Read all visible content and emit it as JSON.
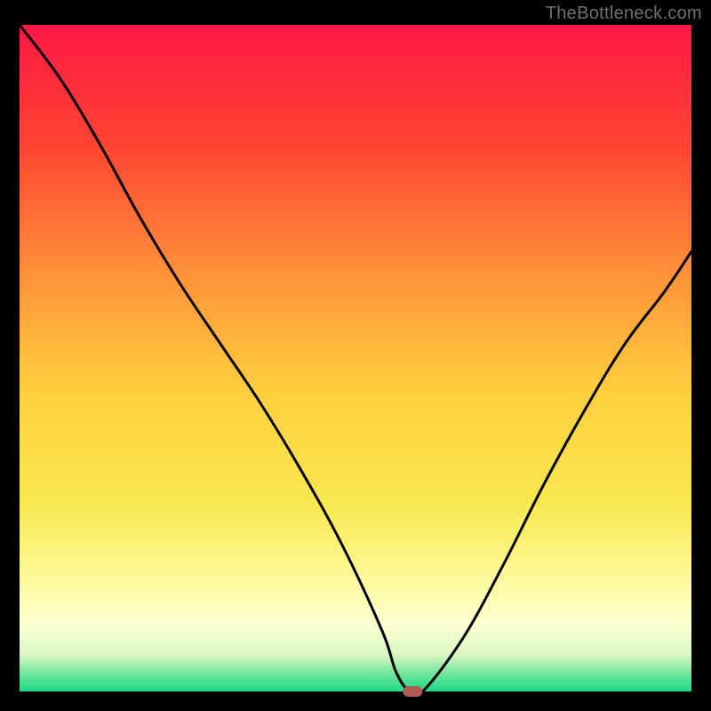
{
  "watermark": "TheBottleneck.com",
  "chart_data": {
    "type": "line",
    "title": "",
    "xlabel": "",
    "ylabel": "",
    "xlim": [
      0,
      100
    ],
    "ylim": [
      0,
      100
    ],
    "x": [
      0,
      6,
      12,
      18,
      24,
      30,
      36,
      42,
      48,
      54,
      56,
      58,
      60,
      66,
      72,
      78,
      84,
      90,
      96,
      100
    ],
    "values": [
      100,
      92,
      82,
      71,
      61,
      52,
      43,
      33,
      22,
      9,
      3,
      0,
      0,
      8,
      19,
      31,
      42,
      52,
      60,
      66
    ],
    "optimum_marker": {
      "x": 58.5,
      "y": 0,
      "color": "#b15a54"
    },
    "background_gradient": {
      "stops": [
        {
          "offset": 0.0,
          "color": "#ff1846"
        },
        {
          "offset": 0.18,
          "color": "#ff4432"
        },
        {
          "offset": 0.38,
          "color": "#ff943a"
        },
        {
          "offset": 0.55,
          "color": "#ffcf3e"
        },
        {
          "offset": 0.72,
          "color": "#f8e850"
        },
        {
          "offset": 0.83,
          "color": "#fff99a"
        },
        {
          "offset": 0.9,
          "color": "#feffd2"
        },
        {
          "offset": 0.945,
          "color": "#d9f8c3"
        },
        {
          "offset": 0.97,
          "color": "#7de7a0"
        },
        {
          "offset": 1.0,
          "color": "#1bd884"
        }
      ]
    },
    "frame_color": "#000000",
    "curve_color": "#000000"
  }
}
